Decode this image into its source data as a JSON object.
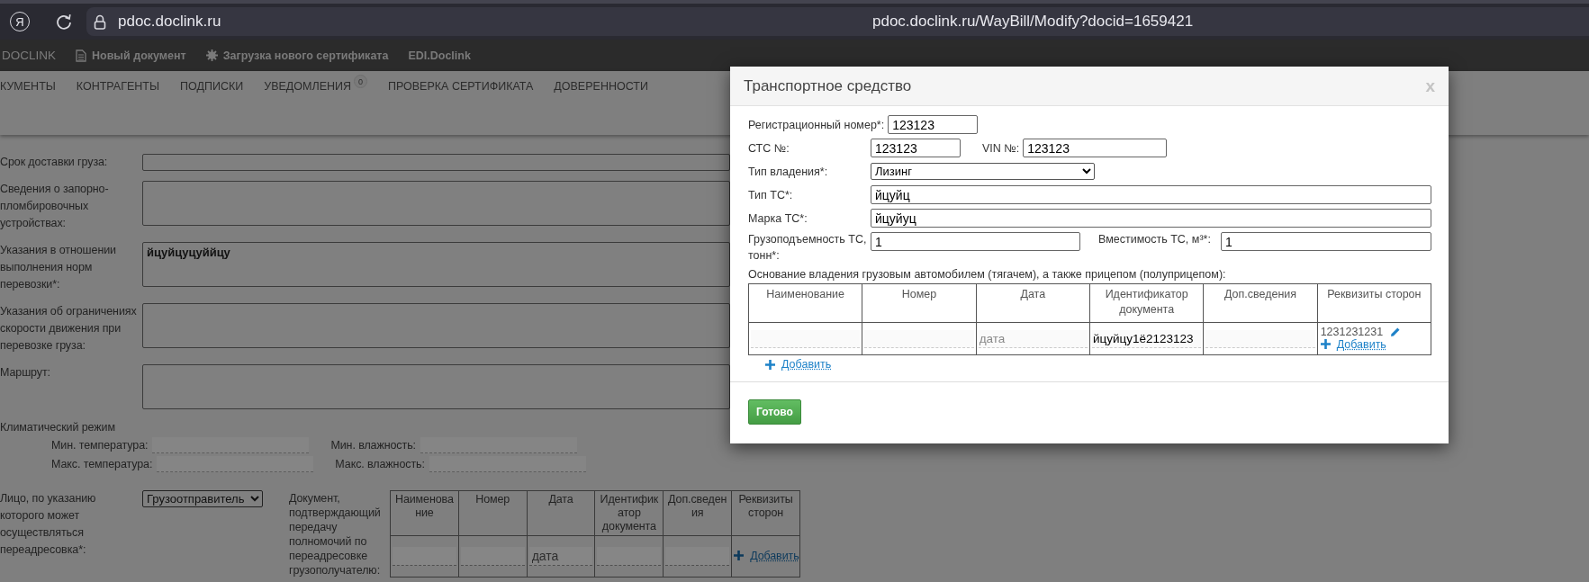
{
  "browser": {
    "logo": "Я",
    "site": "pdoc.doclink.ru",
    "url": "pdoc.doclink.ru/WayBill/Modify?docid=1659421"
  },
  "app_nav": [
    {
      "label": "DOCLINK",
      "kind": "brand"
    },
    {
      "label": "Новый документ",
      "kind": "document"
    },
    {
      "label": "Загрузка нового сертификата",
      "kind": "gear"
    },
    {
      "label": "EDI.Doclink",
      "kind": "plain"
    }
  ],
  "menu": [
    {
      "label": "КУМЕНТЫ"
    },
    {
      "label": "КОНТРАГЕНТЫ"
    },
    {
      "label": "ПОДПИСКИ"
    },
    {
      "label": "УВЕДОМЛЕНИЯ",
      "badge": "0"
    },
    {
      "label": "ПРОВЕРКА СЕРТИФИКАТА"
    },
    {
      "label": "ДОВЕРЕННОСТИ"
    }
  ],
  "form": {
    "rows": [
      {
        "label": "Срок доставки груза:",
        "kind": "input"
      },
      {
        "label": "Сведения о запорно-пломбировочных устройствах:",
        "kind": "textarea"
      },
      {
        "label": "Указания в отношении выполнения норм перевозки*:",
        "kind": "textarea",
        "value": "йцуйцуцуййцу"
      },
      {
        "label": "Указания об ограничениях скорости движения при перевозке груза:",
        "kind": "textarea"
      },
      {
        "label": "Маршрут:",
        "kind": "textarea"
      }
    ],
    "climate": {
      "title": "Климатический режим",
      "fields": [
        {
          "label": "Мин. температура:"
        },
        {
          "label": "Мин. влажность:"
        },
        {
          "label": "Макс. температура:"
        },
        {
          "label": "Макс. влажность:"
        }
      ]
    },
    "redirect": {
      "label": "Лицо, по указанию которого может осуществляться переадресовка*:",
      "value": "Грузоотправитель"
    },
    "document": {
      "label": "Документ, подтверждающий передачу полномочий по переадресовке грузополучателю:",
      "columns": [
        "Наименование",
        "Номер",
        "Дата",
        "Идентификатор документа",
        "Доп.сведения",
        "Реквизиты сторон"
      ],
      "row": [
        {
          "kind": "field"
        },
        {
          "kind": "field"
        },
        {
          "kind": "field",
          "placeholder": "дата"
        },
        {
          "kind": "field"
        },
        {
          "kind": "field"
        },
        {
          "kind": "add",
          "link": "Добавить"
        }
      ]
    }
  },
  "modal": {
    "title": "Транспортное средство",
    "close": "x",
    "registration": {
      "label": "Регистрационный номер*:",
      "value": "123123"
    },
    "sts": {
      "label": "СТС №:",
      "value": "123123"
    },
    "vin": {
      "label": "VIN №:",
      "value": "123123"
    },
    "ownership": {
      "label": "Тип владения*:",
      "value": "Лизинг"
    },
    "vehicle_type": {
      "label": "Тип ТС*:",
      "value": "йцуйц"
    },
    "brand": {
      "label": "Марка ТС*:",
      "value": "йцуйуц"
    },
    "capacity": {
      "label": "Грузоподъемность ТС, тонн*:",
      "value": "1"
    },
    "volume": {
      "label": "Вместимость ТС, м³*:",
      "value": "1"
    },
    "basis": {
      "caption": "Основание владения грузовым автомобилем (тягачем), а также прицепом (полуприцепом):",
      "columns": [
        "Наименование",
        "Номер",
        "Дата",
        "Идентификатор документа",
        "Доп.сведения",
        "Реквизиты сторон"
      ],
      "row": [
        {
          "kind": "field"
        },
        {
          "kind": "field"
        },
        {
          "kind": "field",
          "placeholder": "дата"
        },
        {
          "kind": "field",
          "value": "йцуйцу1ё2123123"
        },
        {
          "kind": "field"
        },
        {
          "kind": "parties",
          "value": "1231231231",
          "link": "Добавить"
        }
      ],
      "add_link": "Добавить"
    },
    "done_button": "Готово"
  }
}
